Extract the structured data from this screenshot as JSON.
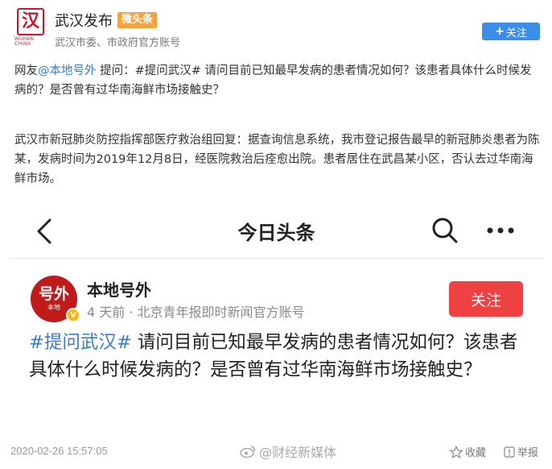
{
  "account": {
    "logo_char": "汉",
    "logo_sub": "WUHAN CHINA",
    "name": "武汉发布",
    "badge": "微头条",
    "description": "武汉市委、市政府官方账号",
    "follow_label": "关注",
    "follow_plus": "+"
  },
  "post": {
    "question": {
      "prefix": "网友",
      "mention": "@本地号外",
      "text": " 提问：#提问武汉# 请问目前已知最早发病的患者情况如何？该患者具体什么时候发病的？是否曾有过华南海鲜市场接触史？"
    },
    "answer": "武汉市新冠肺炎防控指挥部医疗救治组回复：据查询信息系统，我市登记报告最早的新冠肺炎患者为陈某，发病时间为2019年12月8日，经医院救治后痊愈出院。患者居住在武昌某小区，否认去过华南海鲜市场。"
  },
  "embedded": {
    "nav_title": "今日头条",
    "avatar_main": "号外",
    "avatar_sub": "本地",
    "verified_mark": "V",
    "account_name": "本地号外",
    "meta": "4 天前 · 北京青年报即时新闻官方账号",
    "follow_label": "关注",
    "hashtag": "#提问武汉#",
    "question_text": " 请问目前已知最早发病的患者情况如何？该患者具体什么时候发病的？是否曾有过华南海鲜市场接触史？"
  },
  "footer": {
    "timestamp": "2020-02-26 15:57:05",
    "watermark": "@财经新媒体",
    "favorite_label": "收藏",
    "report_label": "举报"
  },
  "colors": {
    "brand_red": "#c8162f",
    "follow_blue": "#3b8ee8",
    "follow_red": "#f04142",
    "link_blue": "#3b7cc7",
    "badge_orange": "#f4a23b"
  },
  "icons": [
    "back-arrow-icon",
    "search-icon",
    "more-icon",
    "verified-icon",
    "weibo-icon",
    "star-icon",
    "report-icon"
  ]
}
